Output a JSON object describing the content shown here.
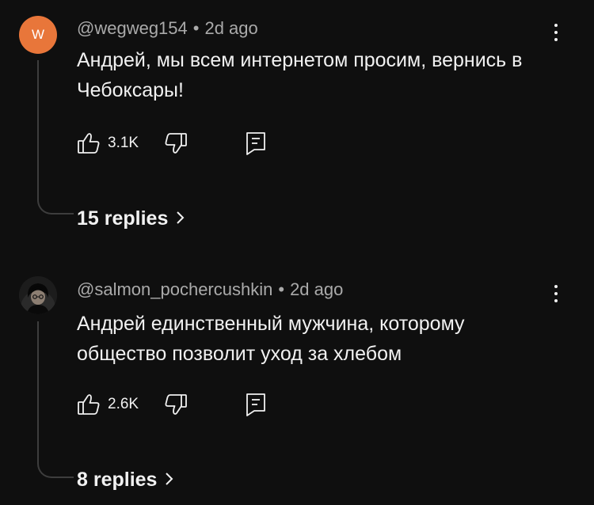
{
  "comments": [
    {
      "avatar_letter": "W",
      "author": "@wegweg154",
      "separator": "•",
      "time": "2d ago",
      "text": "Андрей, мы всем интернетом просим, вернись в Чебоксары!",
      "likes": "3.1K",
      "replies_label": "15 replies"
    },
    {
      "author": "@salmon_pochercushkin",
      "separator": "•",
      "time": "2d ago",
      "text": "Андрей единственный мужчина, которому общество позволит уход за хлебом",
      "likes": "2.6K",
      "replies_label": "8 replies"
    }
  ],
  "colors": {
    "background": "#0f0f0f",
    "avatar_orange": "#e8763a",
    "meta_text": "#aaaaaa",
    "primary_text": "#f1f1f1"
  },
  "icons": [
    "thumbs-up-icon",
    "thumbs-down-icon",
    "reply-comment-icon",
    "chevron-right-icon",
    "more-vert-icon"
  ]
}
